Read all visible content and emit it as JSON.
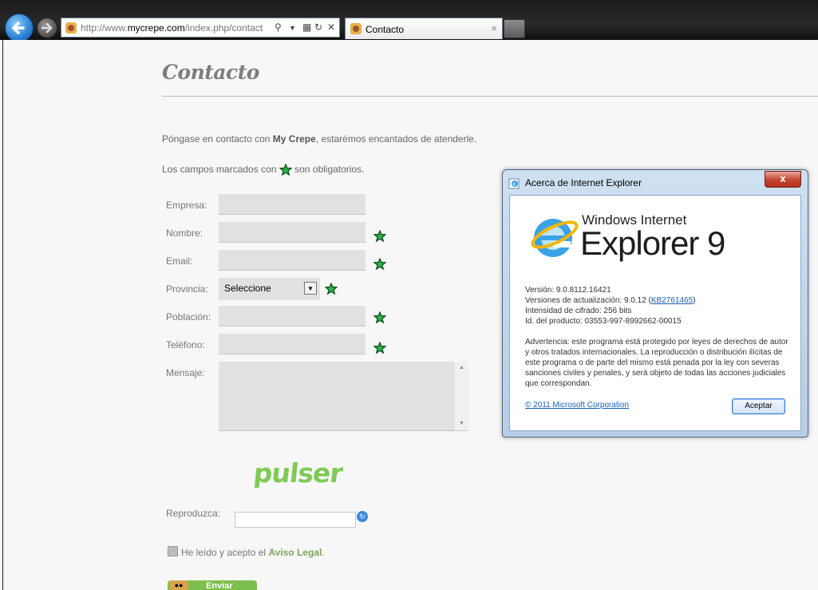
{
  "browser": {
    "url_prefix": "http://www.",
    "url_domain": "mycrepe.com",
    "url_path": "/index.php/contact",
    "tab_title": "Contacto",
    "tab_close": "×"
  },
  "page": {
    "heading": "Contacto",
    "intro_start": "Póngase en contacto con ",
    "intro_brand": "My Crepe",
    "intro_end": ", estarémos encantados de atenderle.",
    "required_start": "Los campos marcados con ",
    "required_end": " son obligatorios.",
    "fields": {
      "empresa": "Empresa:",
      "nombre": "Nombre:",
      "email": "Email:",
      "provincia": "Provincia:",
      "poblacion": "Población:",
      "telefono": "Teléfono:",
      "mensaje": "Mensaje:"
    },
    "provincia_value": "Seleccione",
    "captcha_text": "pulser",
    "reproduzca_label": "Reproduzca:",
    "legal_text": "He leído y acepto el ",
    "legal_link": "Aviso Legal",
    "legal_end": ".",
    "send_label": "Enviar"
  },
  "dialog": {
    "title": "Acerca de Internet Explorer",
    "close": "x",
    "brand_top": "Windows Internet",
    "brand_main": "Explorer 9",
    "version": "Versión: 9.0.8112.16421",
    "updates_prefix": "Versiones de actualización: 9.0.12 (",
    "updates_link": "KB2761465",
    "updates_suffix": ")",
    "cipher": "Intensidad de cifrado: 256 bits",
    "product_id": "Id. del producto: 03553-997-8992662-00015",
    "warning": "Advertencia: este programa está protegido por leyes de derechos de autor y otros tratados internacionales. La reproducción o distribución ilícitas de este programa o de parte del mismo está penada por la ley con severas sanciones civiles y penales, y será objeto de todas las acciones judiciales que correspondan.",
    "copyright": "© 2011 Microsoft Corporation",
    "ok_button": "Aceptar"
  }
}
